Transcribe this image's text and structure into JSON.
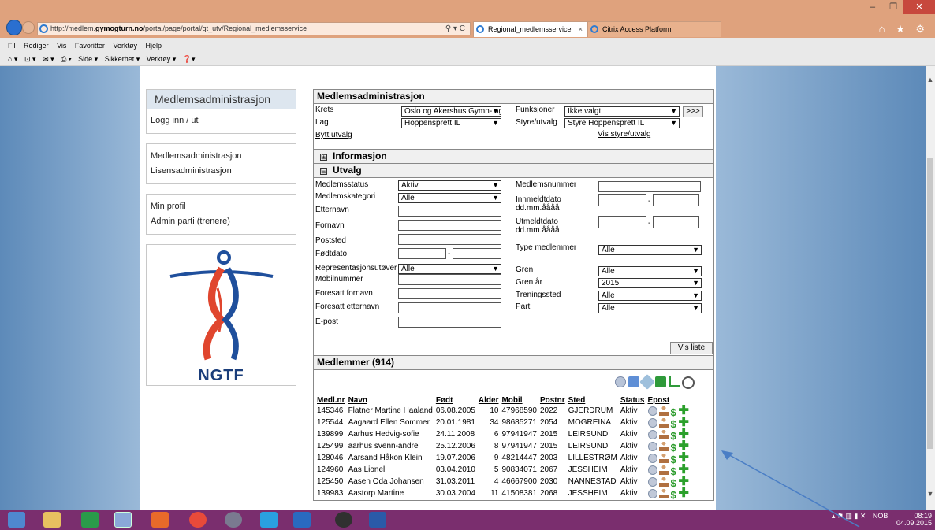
{
  "browser": {
    "url_prefix": "http://medlem.",
    "url_domain": "gymogturn.no",
    "url_path": "/portal/page/portal/gt_utv/Regional_medlemsservice",
    "addr_controls": "⚲ ▾ C",
    "tabs": [
      {
        "label": "Regional_medlemsservice",
        "close": "×"
      },
      {
        "label": "Citrix Access Platform"
      }
    ],
    "window_controls": [
      "–",
      "❐",
      "✕"
    ],
    "fav_icons": "⌂ ★ ⚙",
    "menu": [
      "Fil",
      "Rediger",
      "Vis",
      "Favoritter",
      "Verktøy",
      "Hjelp"
    ],
    "commands": [
      "⌂ ▾",
      "⊡ ▾",
      "✉ ▾",
      "⎙ ▾",
      "Side ▾",
      "Sikkerhet ▾",
      "Verktøy ▾",
      "❓▾"
    ]
  },
  "left": {
    "box1_title": "Medlemsadministrasjon",
    "box1_items": [
      "Logg inn / ut"
    ],
    "box2_items": [
      "Medlemsadministrasjon",
      "Lisensadministrasjon"
    ],
    "box3_items": [
      "Min profil",
      "Admin parti (trenere)"
    ],
    "logo_text": "NGTF"
  },
  "main": {
    "title": "Medlemsadministrasjon",
    "krets_label": "Krets",
    "krets_value": "Oslo og Akershus Gymn- og",
    "lag_label": "Lag",
    "lag_value": "Hoppensprett IL",
    "bytt_link": "Bytt utvalg",
    "funksjoner_label": "Funksjoner",
    "funksjoner_value": "Ikke valgt",
    "go_button": ">>>",
    "styre_label": "Styre/utvalg",
    "styre_value": "Styre Hoppensprett IL",
    "vis_styre_link": "Vis styre/utvalg",
    "info_section": "Informasjon",
    "utvalg_section": "Utvalg",
    "info_pm": "⊞",
    "utvalg_pm": "⊟",
    "form": {
      "medlemsstatus": {
        "label": "Medlemsstatus",
        "value": "Aktiv"
      },
      "medlemskategori": {
        "label": "Medlemskategori",
        "value": "Alle"
      },
      "etternavn": "Etternavn",
      "fornavn": "Fornavn",
      "poststed": "Poststed",
      "fodtdato": "Fødtdato",
      "representasjon": {
        "label": "Representasjonsutøver",
        "value": "Alle"
      },
      "mobil": "Mobilnummer",
      "foresatt_fornavn": "Foresatt fornavn",
      "foresatt_etternavn": "Foresatt etternavn",
      "epost": "E-post",
      "medlemsnummer": "Medlemsnummer",
      "innmeldt": "Innmeldtdato dd.mm.åååå",
      "utmeldt": "Utmeldtdato dd.mm.åååå",
      "type": {
        "label": "Type medlemmer",
        "value": "Alle"
      },
      "gren": {
        "label": "Gren",
        "value": "Alle"
      },
      "gren_ar": {
        "label": "Gren år",
        "value": "2015"
      },
      "treningssted": {
        "label": "Treningssted",
        "value": "Alle"
      },
      "parti": {
        "label": "Parti",
        "value": "Alle"
      },
      "dash": "-",
      "vis_liste": "Vis liste"
    },
    "members_title": "Medlemmer (914)",
    "columns": [
      "Medl.nr",
      "Navn",
      "Født",
      "Alder",
      "Mobil",
      "Postnr",
      "Sted",
      "Status",
      "Epost"
    ],
    "rows": [
      [
        "145346",
        "Flatner Martine Haaland",
        "06.08.2005",
        "10",
        "47968590",
        "2022",
        "GJERDRUM",
        "Aktiv"
      ],
      [
        "125544",
        "Aagaard Ellen Sommer",
        "20.01.1981",
        "34",
        "98685271",
        "2054",
        "MOGREINA",
        "Aktiv"
      ],
      [
        "139899",
        "Aarhus Hedvig-sofie",
        "24.11.2008",
        "6",
        "97941947",
        "2015",
        "LEIRSUND",
        "Aktiv"
      ],
      [
        "125499",
        "aarhus svenn-andre",
        "25.12.2006",
        "8",
        "97941947",
        "2015",
        "LEIRSUND",
        "Aktiv"
      ],
      [
        "128046",
        "Aarsand Håkon Klein",
        "19.07.2006",
        "9",
        "48214447",
        "2003",
        "LILLESTRØM",
        "Aktiv"
      ],
      [
        "124960",
        "Aas Lionel",
        "03.04.2010",
        "5",
        "90834071",
        "2067",
        "JESSHEIM",
        "Aktiv"
      ],
      [
        "125450",
        "Aasen Oda Johansen",
        "31.03.2011",
        "4",
        "46667900",
        "2030",
        "NANNESTAD",
        "Aktiv"
      ],
      [
        "139983",
        "Aastorp Martine",
        "30.03.2004",
        "11",
        "41508381",
        "2068",
        "JESSHEIM",
        "Aktiv"
      ]
    ],
    "row_icons": {
      "dollar": "$",
      "plus": "✚"
    }
  },
  "taskbar": {
    "lang": "NOB",
    "time": "08:19",
    "date": "04.09.2015",
    "tray_icons": "▴ ⚑ ▥ ▮ ✕"
  },
  "colors": {
    "titlebar": "#dfa27d",
    "taskbar": "#7a2e6e",
    "arrow": "#4a7ec5",
    "header_bg": "#dde6ef"
  }
}
